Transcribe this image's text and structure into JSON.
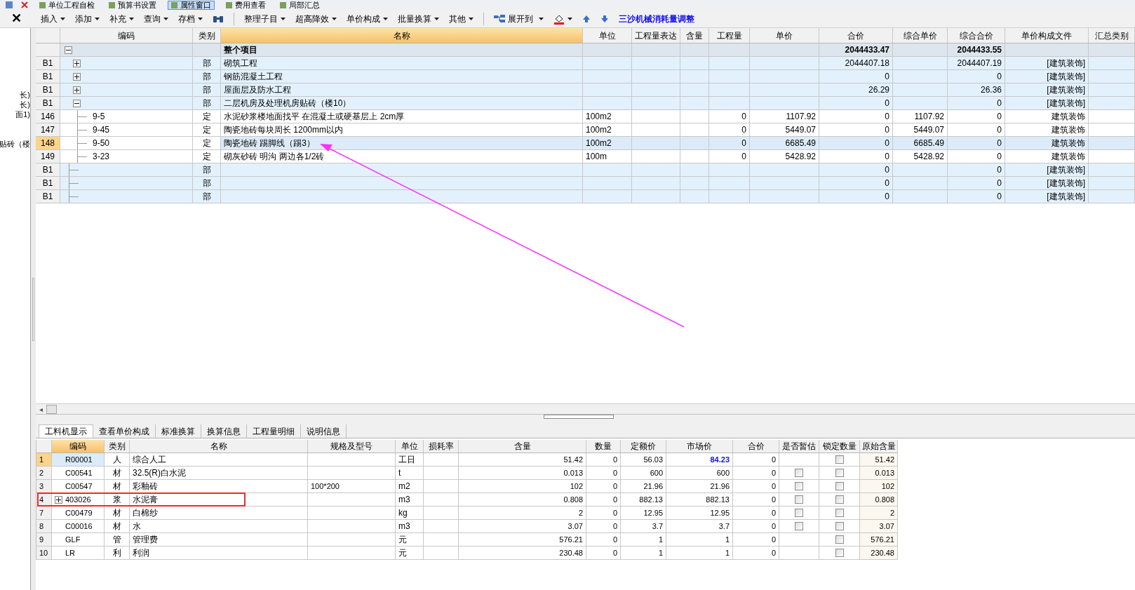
{
  "top_strip": {
    "items": [
      {
        "label": "单位工程自检",
        "selected": false
      },
      {
        "label": "预算书设置",
        "selected": false
      },
      {
        "label": "属性窗口",
        "selected": true
      },
      {
        "label": "费用查看",
        "selected": false
      },
      {
        "label": "局部汇总",
        "selected": false
      }
    ]
  },
  "toolbar": {
    "close_glyph": "✕",
    "items": [
      {
        "kind": "menu",
        "label": "插入"
      },
      {
        "kind": "menu",
        "label": "添加"
      },
      {
        "kind": "menu",
        "label": "补充"
      },
      {
        "kind": "menu",
        "label": "查询"
      },
      {
        "kind": "menu",
        "label": "存档"
      },
      {
        "kind": "tool"
      },
      {
        "kind": "separator"
      },
      {
        "kind": "menu",
        "label": "整理子目"
      },
      {
        "kind": "menu",
        "label": "超高降效"
      },
      {
        "kind": "menu",
        "label": "单价构成"
      },
      {
        "kind": "menu",
        "label": "批量换算"
      },
      {
        "kind": "menu",
        "label": "其他"
      },
      {
        "kind": "separator"
      },
      {
        "kind": "icon_menu",
        "label": "展开到"
      },
      {
        "kind": "color_menu",
        "color": "#ff0000"
      },
      {
        "kind": "up"
      },
      {
        "kind": "down"
      },
      {
        "kind": "link",
        "label": "三沙机械消耗量调整"
      }
    ]
  },
  "left_panel": {
    "fragments": [
      "长)",
      "长)",
      "面1)",
      "贴砖（楼"
    ]
  },
  "upper_table": {
    "columns": [
      "编码",
      "类别",
      "名称",
      "单位",
      "工程量表达",
      "含量",
      "工程量",
      "单价",
      "合价",
      "综合单价",
      "综合合价",
      "单价构成文件",
      "汇总类别"
    ],
    "rows": [
      {
        "kind": "root",
        "name": "整个项目",
        "total": "2044433.47",
        "comp_total": "2044433.55",
        "expanded": true,
        "selected": false,
        "children": [
          {
            "kind": "section",
            "no": "B1",
            "type": "部",
            "name": "砌筑工程",
            "total": "2044407.18",
            "comp_total": "2044407.19",
            "template": "[建筑装饰]",
            "expanded": false,
            "selected": false
          },
          {
            "kind": "section",
            "no": "B1",
            "type": "部",
            "name": "钢筋混凝土工程",
            "total": "0",
            "comp_total": "0",
            "template": "[建筑装饰]",
            "expanded": false,
            "selected": false
          },
          {
            "kind": "section",
            "no": "B1",
            "type": "部",
            "name": "屋面层及防水工程",
            "total": "26.29",
            "comp_total": "26.36",
            "template": "[建筑装饰]",
            "expanded": false,
            "selected": false
          },
          {
            "kind": "section",
            "no": "B1",
            "type": "部",
            "name": "二层机房及处理机房贴砖（楼10）",
            "total": "0",
            "comp_total": "0",
            "template": "[建筑装饰]",
            "expanded": true,
            "selected": false,
            "children": [
              {
                "kind": "item",
                "no": "146",
                "code": "9-5",
                "type": "定",
                "name": "水泥砂浆楼地面找平 在混凝土或硬基层上 2cm厚",
                "unit": "100m2",
                "quantity": "0",
                "unit_price": "1107.92",
                "total": "0",
                "comp_unit_price": "1107.92",
                "comp_total": "0",
                "template": "建筑装饰",
                "selected": false
              },
              {
                "kind": "item",
                "no": "147",
                "code": "9-45",
                "type": "定",
                "name": "陶瓷地砖每块周长 1200mm以内",
                "unit": "100m2",
                "quantity": "0",
                "unit_price": "5449.07",
                "total": "0",
                "comp_unit_price": "5449.07",
                "comp_total": "0",
                "template": "建筑装饰",
                "selected": false
              },
              {
                "kind": "item",
                "no": "148",
                "code": "9-50",
                "type": "定",
                "name": "陶瓷地砖 踢脚线（踢3）",
                "unit": "100m2",
                "quantity": "0",
                "unit_price": "6685.49",
                "total": "0",
                "comp_unit_price": "6685.49",
                "comp_total": "0",
                "template": "建筑装饰",
                "selected": true
              },
              {
                "kind": "item",
                "no": "149",
                "code": "3-23",
                "type": "定",
                "name": "砌灰砂砖 明沟 两边各1/2砖",
                "unit": "100m",
                "quantity": "0",
                "unit_price": "5428.92",
                "total": "0",
                "comp_unit_price": "5428.92",
                "comp_total": "0",
                "template": "建筑装饰",
                "selected": false
              }
            ]
          },
          {
            "kind": "section",
            "no": "B1",
            "type": "部",
            "total": "0",
            "comp_total": "0",
            "template": "[建筑装饰]",
            "selected": false
          },
          {
            "kind": "section",
            "no": "B1",
            "type": "部",
            "total": "0",
            "comp_total": "0",
            "template": "[建筑装饰]",
            "selected": false
          },
          {
            "kind": "section",
            "no": "B1",
            "type": "部",
            "total": "0",
            "comp_total": "0",
            "template": "[建筑装饰]",
            "selected": false
          }
        ]
      }
    ]
  },
  "scrollbar_glyph": "◂",
  "lower_tabs": [
    {
      "label": "工料机显示",
      "selected": true
    },
    {
      "label": "查看单价构成",
      "selected": false
    },
    {
      "label": "标准换算",
      "selected": false
    },
    {
      "label": "换算信息",
      "selected": false
    },
    {
      "label": "工程量明细",
      "selected": false
    },
    {
      "label": "说明信息",
      "selected": false
    }
  ],
  "lower_table": {
    "columns": [
      "编码",
      "类别",
      "名称",
      "规格及型号",
      "单位",
      "损耗率",
      "含量",
      "数量",
      "定额价",
      "市场价",
      "合价",
      "是否暂估",
      "锁定数量",
      "原始含量"
    ],
    "rows": [
      {
        "no": "1",
        "code": "R00001",
        "type": "人",
        "name": "综合人工",
        "unit": "工日",
        "content": "51.42",
        "qty": "0",
        "quota_price": "56.03",
        "market_price": "84.23",
        "market_changed": true,
        "total": "0",
        "locked": false,
        "original": "51.42",
        "selected": true
      },
      {
        "no": "2",
        "code": "C00541",
        "type": "材",
        "name": "32.5(R)白水泥",
        "unit": "t",
        "content": "0.013",
        "qty": "0",
        "quota_price": "600",
        "market_price": "600",
        "market_changed": false,
        "total": "0",
        "provisional": false,
        "locked": false,
        "original": "0.013",
        "selected": false
      },
      {
        "no": "3",
        "code": "C00547",
        "type": "材",
        "name": "彩釉砖",
        "spec": "100*200",
        "unit": "m2",
        "content": "102",
        "qty": "0",
        "quota_price": "21.96",
        "market_price": "21.96",
        "market_changed": false,
        "total": "0",
        "provisional": false,
        "locked": false,
        "original": "102",
        "selected": false
      },
      {
        "no": "4",
        "code": "403026",
        "type": "浆",
        "name": "水泥膏",
        "unit": "m3",
        "content": "0.808",
        "qty": "0",
        "quota_price": "882.13",
        "market_price": "882.13",
        "market_changed": false,
        "total": "0",
        "provisional": false,
        "locked": false,
        "original": "0.808",
        "expanded": false,
        "selected": false
      },
      {
        "no": "7",
        "code": "C00479",
        "type": "材",
        "name": "白棉纱",
        "unit": "kg",
        "content": "2",
        "qty": "0",
        "quota_price": "12.95",
        "market_price": "12.95",
        "market_changed": false,
        "total": "0",
        "provisional": false,
        "locked": false,
        "original": "2",
        "selected": false
      },
      {
        "no": "8",
        "code": "C00016",
        "type": "材",
        "name": "水",
        "unit": "m3",
        "content": "3.07",
        "qty": "0",
        "quota_price": "3.7",
        "market_price": "3.7",
        "market_changed": false,
        "total": "0",
        "provisional": false,
        "locked": false,
        "original": "3.07",
        "selected": false
      },
      {
        "no": "9",
        "code": "GLF",
        "type": "管",
        "name": "管理费",
        "unit": "元",
        "content": "576.21",
        "qty": "0",
        "quota_price": "1",
        "market_price": "1",
        "market_changed": false,
        "total": "0",
        "locked": false,
        "original": "576.21",
        "selected": false
      },
      {
        "no": "10",
        "code": "LR",
        "type": "利",
        "name": "利润",
        "unit": "元",
        "content": "230.48",
        "qty": "0",
        "quota_price": "1",
        "market_price": "1",
        "market_changed": false,
        "total": "0",
        "locked": false,
        "original": "230.48",
        "selected": false
      }
    ]
  },
  "annotations": [
    {
      "kind": "arrow",
      "color": "#ff33ff"
    },
    {
      "kind": "frame",
      "color": "#ee2a2a"
    }
  ]
}
